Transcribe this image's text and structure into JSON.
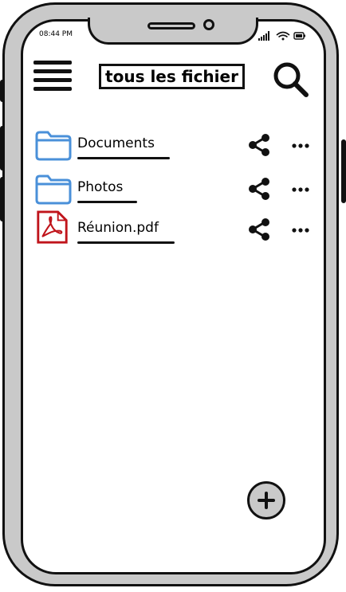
{
  "status_bar": {
    "time": "08:44 PM",
    "icons": [
      "signal-icon",
      "wifi-icon",
      "battery-icon"
    ]
  },
  "header": {
    "menu_icon": "hamburger-menu-icon",
    "title": "tous les fichier",
    "search_icon": "search-icon"
  },
  "files": [
    {
      "name": "Documents",
      "type": "folder",
      "icon": "folder-icon"
    },
    {
      "name": "Photos",
      "type": "folder",
      "icon": "folder-icon"
    },
    {
      "name": "Réunion.pdf",
      "type": "pdf",
      "icon": "pdf-file-icon"
    }
  ],
  "row_actions": {
    "share_icon": "share-icon",
    "more_icon": "more-options-icon"
  },
  "fab": {
    "icon": "add-icon"
  },
  "colors": {
    "folder": "#4a90d9",
    "pdf": "#c0141b",
    "frame": "#c9c9c9",
    "ink": "#111111"
  }
}
